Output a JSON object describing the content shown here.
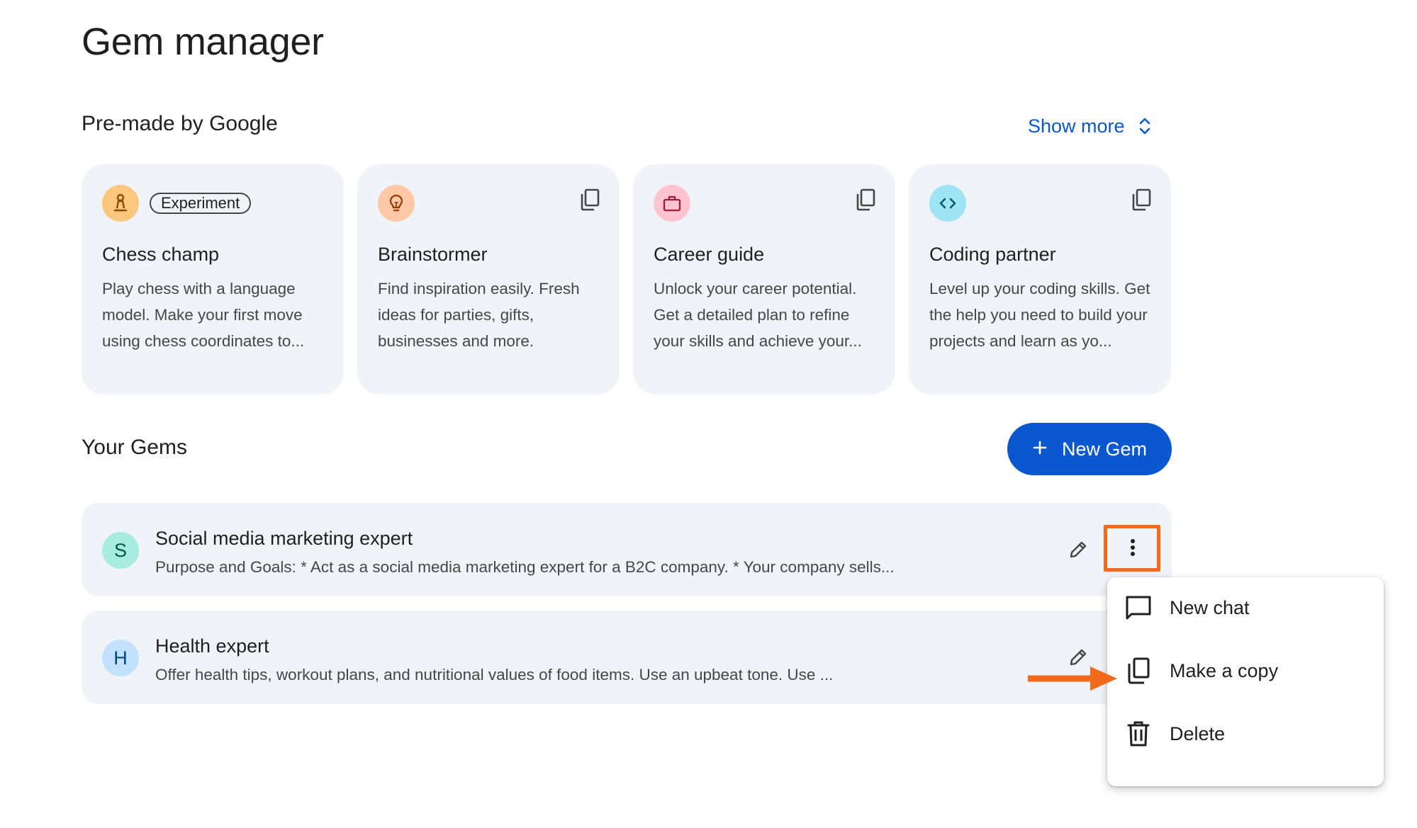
{
  "page": {
    "title": "Gem manager"
  },
  "premade": {
    "title": "Pre-made by Google",
    "show_more": "Show more",
    "cards": [
      {
        "name": "Chess champ",
        "desc": "Play chess with a language model. Make your first move using chess coordinates to...",
        "badge": "Experiment",
        "icon": "chess-pawn-icon",
        "color": "#fbc77c",
        "icon_color": "#8a4a00"
      },
      {
        "name": "Brainstormer",
        "desc": "Find inspiration easily. Fresh ideas for parties, gifts, businesses and more.",
        "icon": "lightbulb-icon",
        "color": "#ffc9a8",
        "icon_color": "#9a3a00"
      },
      {
        "name": "Career guide",
        "desc": "Unlock your career potential. Get a detailed plan to refine your skills and achieve your...",
        "icon": "briefcase-icon",
        "color": "#ffc4cf",
        "icon_color": "#9b1b3a"
      },
      {
        "name": "Coding partner",
        "desc": "Level up your coding skills. Get the help you need to build your projects and learn as yo...",
        "icon": "code-icon",
        "color": "#9fe4f5",
        "icon_color": "#00566b"
      }
    ]
  },
  "your_gems": {
    "title": "Your Gems",
    "new_gem_label": "New Gem",
    "items": [
      {
        "initial": "S",
        "name": "Social media marketing expert",
        "desc": "Purpose and Goals: * Act as a social media marketing expert for a B2C company. * Your company sells...",
        "color": "#a8ece0",
        "text_color": "#00574b"
      },
      {
        "initial": "H",
        "name": "Health expert",
        "desc": "Offer health tips, workout plans, and nutritional values of food items. Use an upbeat tone. Use ...",
        "color": "#c2e1ff",
        "text_color": "#004a77"
      }
    ]
  },
  "menu": {
    "items": [
      {
        "label": "New chat",
        "icon": "chat-bubble-icon"
      },
      {
        "label": "Make a copy",
        "icon": "copy-icon"
      },
      {
        "label": "Delete",
        "icon": "trash-icon"
      }
    ]
  },
  "colors": {
    "accent": "#0b57d0",
    "annotation": "#f26b1d",
    "card_bg": "#f0f4f9"
  }
}
